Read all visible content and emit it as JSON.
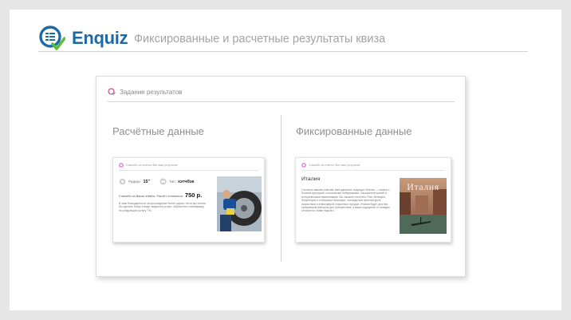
{
  "brand": {
    "name": "Enquiz",
    "mark_color": "#1e6aa8",
    "check_color": "#5bbf3a"
  },
  "header": {
    "title": "Фиксированные и расчетные результаты квиза"
  },
  "panel": {
    "heading": "Задание результатов",
    "icon_color": "#d64aa3",
    "columns": [
      {
        "title": "Расчётные данные"
      },
      {
        "title": "Фиксированные данные"
      }
    ]
  },
  "calc_card": {
    "header_text": "Спасибо за ответы! Вот ваш результат:",
    "radius_label": "Радиус:",
    "radius_value": "15\"",
    "type_label": "Тип:",
    "type_value": "хэтчбэк",
    "cost_label": "Спасибо за Ваши ответы. Расчёт стоимости:",
    "cost_value": "750 р.",
    "note": "В знак благодарности за прохождение более одного теста мы хотели бы сделать бонус в виде скидки на услуги, обратитесь к менеджеру на следующую услугу 7%.",
    "photo_icon": "tire-service-photo"
  },
  "fixed_card": {
    "header_text": "Спасибо за ответы! Вот ваш результат:",
    "title": "Италия",
    "text": "Согласно вашим ответам, вам идеально подходит Италия — страна с богатой культурой, солнечными побережьями, изысканной кухней и историческими памятниками. Вы сможете посетить Рим, Венецию, Флоренцию и побережье Амальфи, насладиться архитектурой, искусством и атмосферой старинных городов. Италия будет для вас прекрасным выбором для путешествия, а ваши ощущения от поездки останутся с вами надолго.",
    "photo_caption": "Италия",
    "photo_icon": "venice-canal-photo"
  }
}
